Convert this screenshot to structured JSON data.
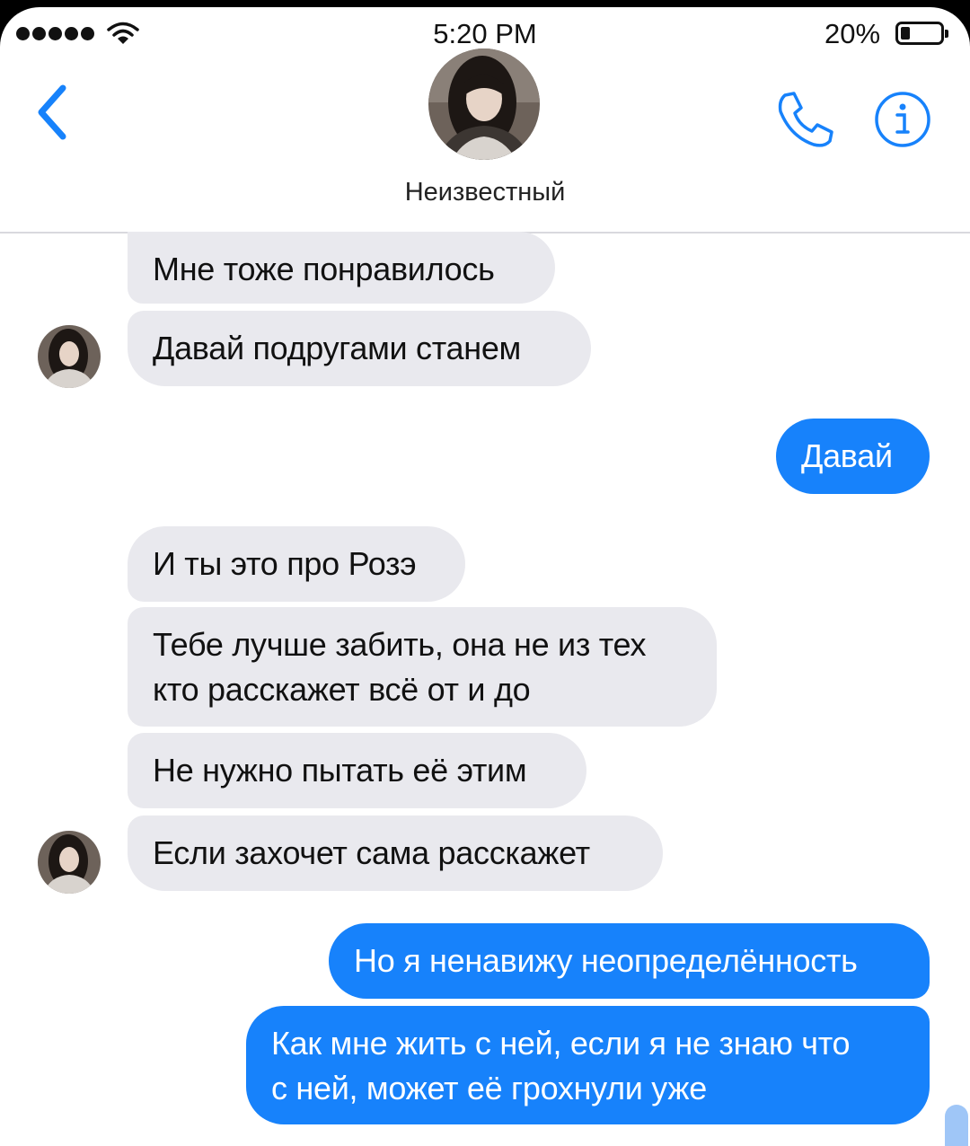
{
  "status_bar": {
    "time": "5:20 PM",
    "battery": "20%"
  },
  "header": {
    "contact_name": "Неизвестный"
  },
  "icons": {
    "back": "chevron-left-icon",
    "call": "phone-icon",
    "info": "info-icon",
    "wifi": "wifi-icon",
    "battery": "battery-icon"
  },
  "colors": {
    "accent": "#1782fb",
    "incoming_bubble": "#e9e9ee"
  },
  "messages": [
    {
      "side": "in",
      "text": "Мне тоже понравилось"
    },
    {
      "side": "in",
      "text": "Давай подругами станем"
    },
    {
      "side": "out",
      "text": "Давай"
    },
    {
      "side": "in",
      "text": "И ты это про Розэ"
    },
    {
      "side": "in",
      "text": "Тебе лучше забить, она не из тех\nкто расскажет всё от и до"
    },
    {
      "side": "in",
      "text": "Не нужно пытать её этим"
    },
    {
      "side": "in",
      "text": "Если захочет сама расскажет"
    },
    {
      "side": "out",
      "text": "Но я ненавижу неопределённость"
    },
    {
      "side": "out",
      "text": "Как мне жить с ней, если я не знаю что\nс ней, может её грохнули уже"
    }
  ]
}
